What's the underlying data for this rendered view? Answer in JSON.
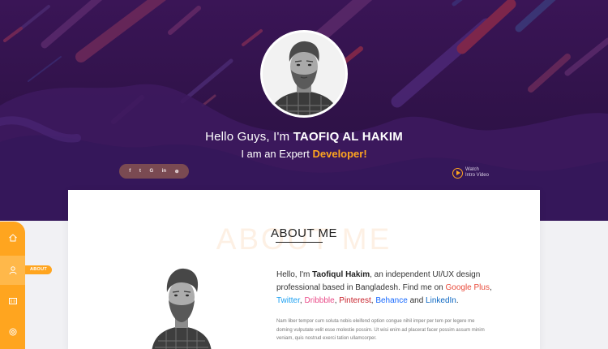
{
  "hero": {
    "greeting_prefix": "Hello Guys, I'm",
    "name": "TAOFIQ AL HAKIM",
    "tagline_prefix": "I am an Expert",
    "tagline_highlight": "Developer!",
    "social": [
      "f",
      "t",
      "G",
      "in",
      "⊛"
    ],
    "social_icons": [
      "facebook-icon",
      "twitter-icon",
      "google-icon",
      "linkedin-icon",
      "dribbble-icon"
    ],
    "watch_line1": "Watch",
    "watch_line2": "Intro Video"
  },
  "about": {
    "ghost_text": "ABOUT ME",
    "title": "ABOUT ME",
    "intro_hello": "Hello, I'm",
    "intro_name": "Taofiqul Hakim",
    "intro_rest": ", an independent UI/UX design professional based in Bangladesh. Find me on",
    "link_google": "Google Plus",
    "link_twitter": "Twitter",
    "link_dribbble": "Dribbble",
    "link_pinterest": "Pinterest",
    "link_behance": "Behance",
    "and_word": "and",
    "link_linkedin": "LinkedIn",
    "lorem": "Nam liber tempor cum soluta nobis eleifend option congue nihil imper per tem por legere me doming vulputate velit esse molestie possim. Ut wisi enim ad placerat facer possim assum minim veniam, quis nostrud exerci tation ullamcorper."
  },
  "sidebar": {
    "items": [
      "home-icon",
      "user-icon",
      "resume-icon",
      "settings-icon"
    ],
    "active_label": "ABOUT"
  },
  "colors": {
    "accent": "#ffa51f",
    "hero_bg": "#2f1248"
  }
}
